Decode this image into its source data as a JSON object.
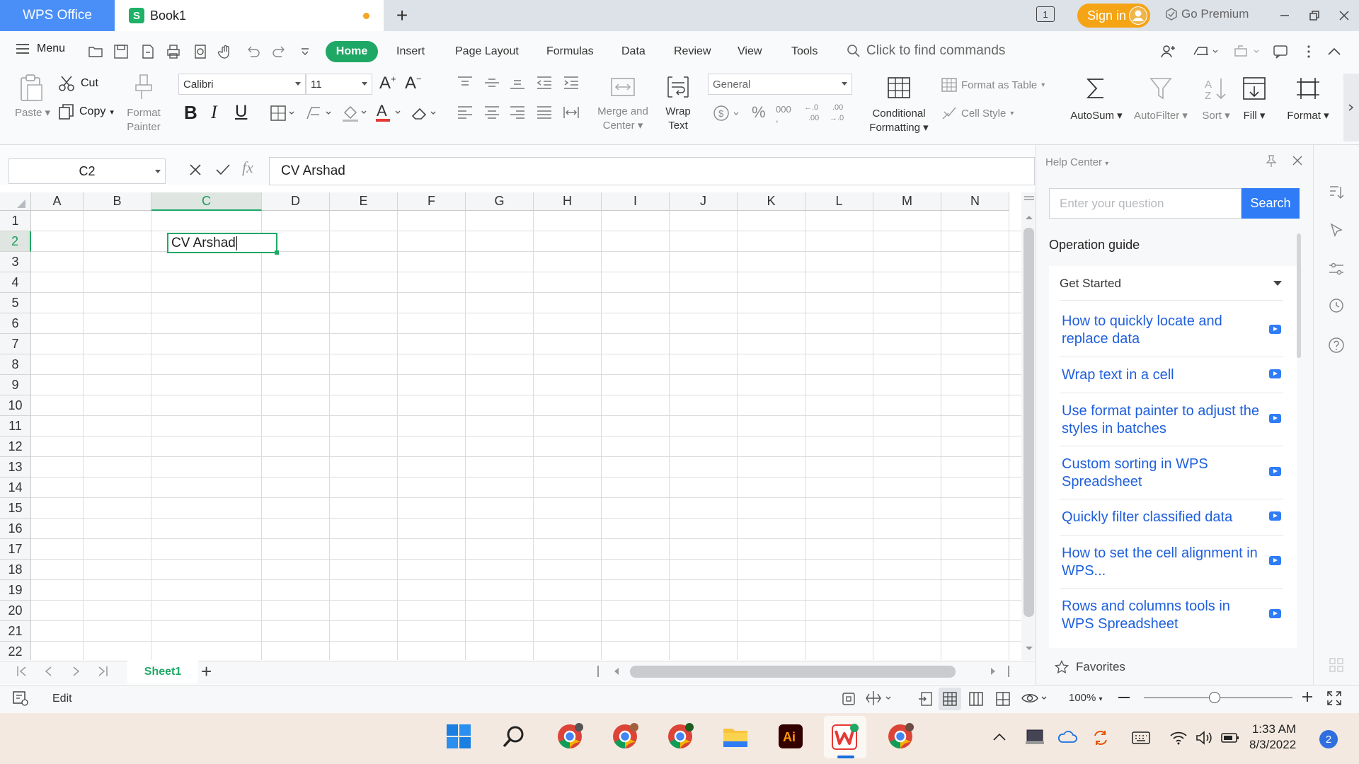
{
  "titlebar": {
    "app_tab": "WPS Office",
    "doc_tab": "Book1",
    "doc_icon_letter": "S",
    "tab_count": "1",
    "sign_in": "Sign in",
    "go_premium": "Go Premium"
  },
  "ribbon": {
    "menu": "Menu",
    "tabs": [
      "Home",
      "Insert",
      "Page Layout",
      "Formulas",
      "Data",
      "Review",
      "View",
      "Tools"
    ],
    "find_commands": "Click to find commands",
    "paste": "Paste",
    "cut": "Cut",
    "copy": "Copy",
    "format_painter_1": "Format",
    "format_painter_2": "Painter",
    "font_name": "Calibri",
    "font_size": "11",
    "bold": "B",
    "italic": "I",
    "underline": "U",
    "merge_1": "Merge and",
    "merge_2": "Center",
    "wrap_1": "Wrap",
    "wrap_2": "Text",
    "number_format": "General",
    "percent": "%",
    "thousands": "000",
    "conditional_1": "Conditional",
    "conditional_2": "Formatting",
    "format_as_table": "Format as Table",
    "cell_style": "Cell Style",
    "autosum": "AutoSum",
    "autofilter": "AutoFilter",
    "sort": "Sort",
    "fill": "Fill",
    "format": "Format"
  },
  "formula_bar": {
    "cell_ref": "C2",
    "fx": "fx",
    "content": "CV Arshad"
  },
  "grid": {
    "columns": [
      "A",
      "B",
      "C",
      "D",
      "E",
      "F",
      "G",
      "H",
      "I",
      "J",
      "K",
      "L",
      "M",
      "N"
    ],
    "rows": [
      "1",
      "2",
      "3",
      "4",
      "5",
      "6",
      "7",
      "8",
      "9",
      "10",
      "11",
      "12",
      "13",
      "14",
      "15",
      "16",
      "17",
      "18",
      "19",
      "20",
      "21",
      "22"
    ],
    "selected_column": "C",
    "selected_row": "2",
    "active_cell_text": "CV Arshad"
  },
  "sheets": {
    "tabs": [
      "Sheet1"
    ],
    "add": "+"
  },
  "status": {
    "mode": "Edit",
    "zoom": "100%"
  },
  "help": {
    "title": "Help Center",
    "placeholder": "Enter your question",
    "search": "Search",
    "operation_guide": "Operation guide",
    "section": "Get Started",
    "items": [
      "How to quickly locate and replace data",
      "Wrap text in a cell",
      "Use format painter to adjust the styles in batches",
      "Custom sorting in WPS Spreadsheet",
      "Quickly filter classified data",
      "How to set the cell alignment in WPS...",
      "Rows and columns tools in WPS Spreadsheet"
    ],
    "favorites": "Favorites"
  },
  "taskbar": {
    "time": "1:33 AM",
    "date": "8/3/2022",
    "notifications": "2",
    "apps": [
      "windows-start",
      "search",
      "chrome",
      "chrome",
      "chrome",
      "file-explorer",
      "illustrator",
      "wps-office",
      "chrome"
    ],
    "illustrator_label": "Ai"
  },
  "colors": {
    "accent_green": "#1fa865",
    "wps_blue": "#4a8ff7",
    "signin_orange": "#f5a415",
    "link_blue": "#1e5fdc"
  }
}
